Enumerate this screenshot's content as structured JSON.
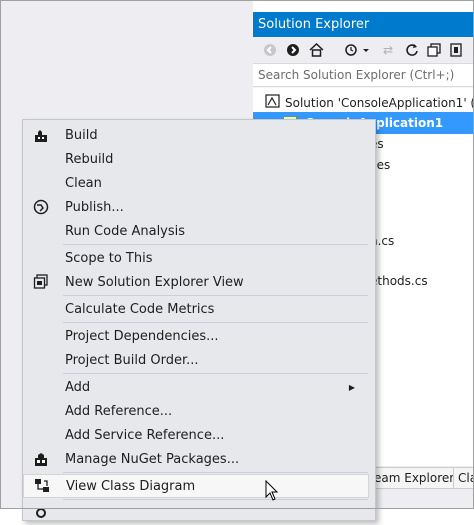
{
  "solution_explorer": {
    "title": "Solution Explorer",
    "search_placeholder": "Search Solution Explorer (Ctrl+;)",
    "solution_node": "Solution 'ConsoleApplication1' (",
    "selected_node": "ConsoleApplication1",
    "partial_nodes": [
      "es",
      "ces",
      "s",
      "n.cs",
      "s",
      "ethods.cs"
    ],
    "bottom_tabs": [
      "eam Explorer",
      "Cla"
    ],
    "accent": "#007acc"
  },
  "context_menu": {
    "items": [
      {
        "label": "Build",
        "icon": "build-icon"
      },
      {
        "label": "Rebuild"
      },
      {
        "label": "Clean"
      },
      {
        "label": "Publish...",
        "icon": "publish-globe-icon"
      },
      {
        "label": "Run Code Analysis"
      },
      {
        "label": "Scope to This"
      },
      {
        "label": "New Solution Explorer View",
        "icon": "new-view-icon"
      },
      {
        "label": "Calculate Code Metrics"
      },
      {
        "label": "Project Dependencies..."
      },
      {
        "label": "Project Build Order..."
      },
      {
        "label": "Add",
        "submenu": true
      },
      {
        "label": "Add Reference..."
      },
      {
        "label": "Add Service Reference..."
      },
      {
        "label": "Manage NuGet Packages...",
        "icon": "nuget-icon"
      },
      {
        "label": "View Class Diagram",
        "icon": "class-diagram-icon",
        "hovered": true
      }
    ]
  }
}
